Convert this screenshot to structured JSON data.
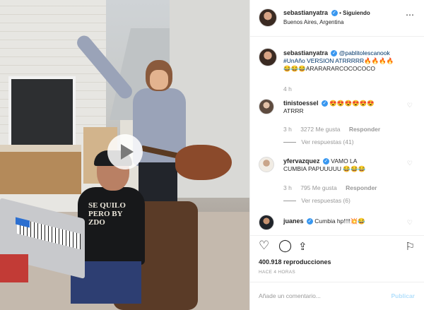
{
  "post": {
    "author": "sebastianyatra",
    "follow_status": "Siguiendo",
    "location": "Buenos Aires, Argentina",
    "caption_mention": "@pablitolescanook",
    "caption_text": "#UnAño VERSION ATRRRRR🔥🔥🔥🔥",
    "caption_line2": "😂😂😂ARARARARCOCOCOCO",
    "caption_time": "4 h",
    "views": "400.918 reproducciones",
    "posted_ago": "HACE 4 HORAS",
    "video_shirt_text": "SE QUILO\nPERO BY\nZDO"
  },
  "comments": [
    {
      "user": "tinistoessel",
      "text": "😍😍😍😍😍😍",
      "text2": "ATRRR",
      "time": "3 h",
      "likes": "3272 Me gusta",
      "reply": "Responder",
      "view_replies": "Ver respuestas (41)"
    },
    {
      "user": "yfervazquez",
      "text": "VAMO LA",
      "text2": "CUMBIA PAPUUUUU 😂😂😂",
      "time": "3 h",
      "likes": "795 Me gusta",
      "reply": "Responder",
      "view_replies": "Ver respuestas (6)"
    },
    {
      "user": "juanes",
      "text": "Cumbia hp!!!!💥😂"
    }
  ],
  "actions": {
    "like_icon": "heart-outline-icon",
    "comment_icon": "comment-bubble-icon",
    "share_icon": "share-arrow-icon",
    "save_icon": "bookmark-icon"
  },
  "comment_box": {
    "placeholder": "Añade un comentario...",
    "publish": "Publicar"
  },
  "colors": {
    "link": "#003569",
    "verified": "#3897f0",
    "publish_disabled": "#b2dffc"
  }
}
